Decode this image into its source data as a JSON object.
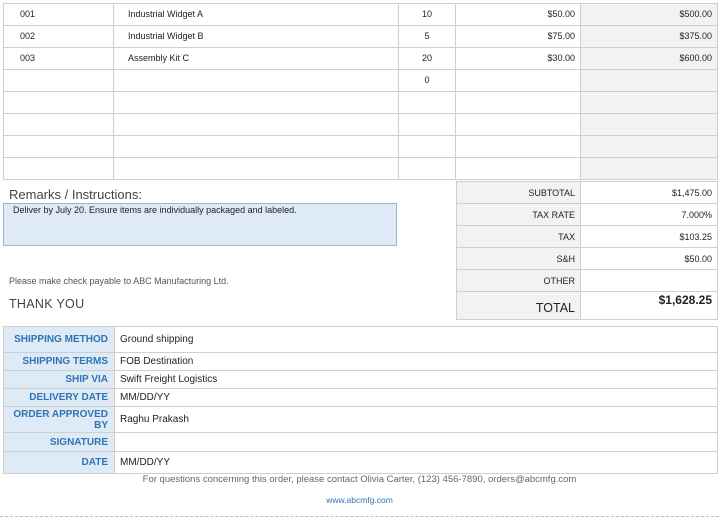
{
  "items": [
    {
      "item_no": "001",
      "description": "Industrial Widget A",
      "qty": "10",
      "unit_price": "$50.00",
      "total": "$500.00"
    },
    {
      "item_no": "002",
      "description": "Industrial Widget B",
      "qty": "5",
      "unit_price": "$75.00",
      "total": "$375.00"
    },
    {
      "item_no": "003",
      "description": "Assembly Kit C",
      "qty": "20",
      "unit_price": "$30.00",
      "total": "$600.00"
    },
    {
      "item_no": "",
      "description": "",
      "qty": "0",
      "unit_price": "",
      "total": ""
    },
    {
      "item_no": "",
      "description": "",
      "qty": "",
      "unit_price": "",
      "total": ""
    },
    {
      "item_no": "",
      "description": "",
      "qty": "",
      "unit_price": "",
      "total": ""
    },
    {
      "item_no": "",
      "description": "",
      "qty": "",
      "unit_price": "",
      "total": ""
    },
    {
      "item_no": "",
      "description": "",
      "qty": "",
      "unit_price": "",
      "total": ""
    }
  ],
  "remarks": {
    "title": "Remarks / Instructions:",
    "text": "Deliver by July 20. Ensure items are individually packaged and labeled."
  },
  "check_note": "Please make check payable to ABC Manufacturing Ltd.",
  "thank_you": "THANK YOU",
  "totals": {
    "subtotal_label": "SUBTOTAL",
    "subtotal": "$1,475.00",
    "tax_rate_label": "TAX RATE",
    "tax_rate": "7.000%",
    "tax_label": "TAX",
    "tax": "$103.25",
    "sh_label": "S&H",
    "sh": "$50.00",
    "other_label": "OTHER",
    "other": "",
    "total_label": "TOTAL",
    "total": "$1,628.25"
  },
  "shipping": {
    "method_label": "SHIPPING METHOD",
    "method": "Ground shipping",
    "terms_label": "SHIPPING TERMS",
    "terms": "FOB Destination",
    "via_label": "SHIP VIA",
    "via": "Swift Freight Logistics",
    "delivery_label": "DELIVERY DATE",
    "delivery": "MM/DD/YY",
    "approved_label": "ORDER APPROVED BY",
    "approved": "Raghu Prakash",
    "signature_label": "SIGNATURE",
    "signature": "",
    "date_label": "DATE",
    "date": "MM/DD/YY"
  },
  "contact": "For questions concerning this order, please contact Olivia Carter, (123) 456-7890, orders@abcmfg.com",
  "website": "www.abcmfg.com"
}
